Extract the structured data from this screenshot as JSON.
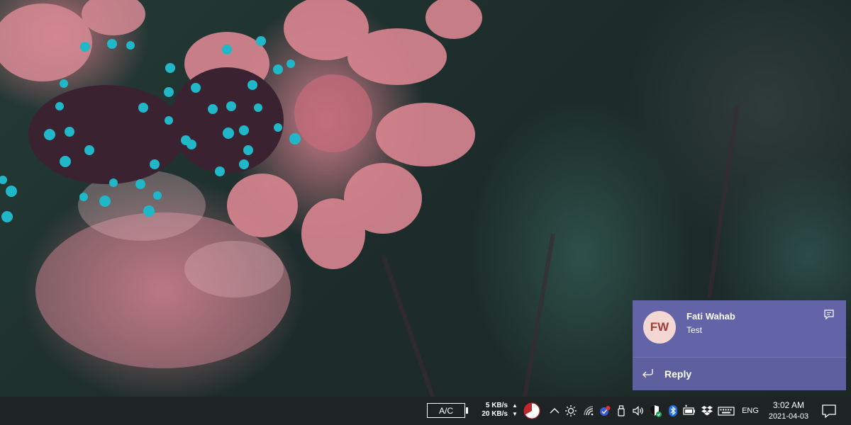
{
  "notification": {
    "avatar_initials": "FW",
    "sender": "Fati Wahab",
    "message": "Test",
    "reply_label": "Reply",
    "icon": "chat-bubble-icon",
    "background": "#6264a7"
  },
  "taskbar": {
    "background": "#1e2423",
    "power_label": "A/C",
    "network_speed": {
      "upload": "5 KB/s",
      "download": "20 KB/s"
    },
    "tray_icons": [
      "pie-chart-icon",
      "chevron-up-icon",
      "brightness-icon",
      "wifi-icon",
      "app-badge-icon",
      "usb-device-icon",
      "volume-icon",
      "security-shield-icon",
      "bluetooth-icon",
      "battery-icon",
      "dropbox-icon",
      "keyboard-icon",
      "action-center-icon"
    ],
    "language": "ENG",
    "time": "3:02 AM",
    "date": "2021-04-03"
  }
}
